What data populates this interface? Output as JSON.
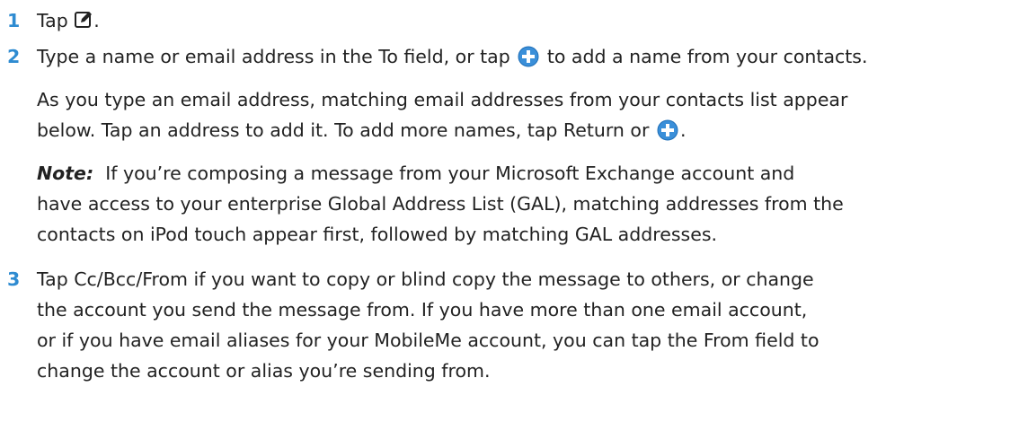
{
  "steps": [
    {
      "number": "1",
      "text_before": "Tap",
      "icon": "compose-icon",
      "text_after": "."
    },
    {
      "number": "2",
      "text_before": "Type a name or email address in the To field, or tap",
      "icon": "add-contact-icon",
      "text_after": "to add a name from your contacts.",
      "detail_before": "As you type an email address, matching email addresses from your contacts list appear",
      "detail_line2_before": "below. Tap an address to add it. To add more names, tap Return or",
      "detail_icon": "add-contact-icon",
      "detail_after": ".",
      "note_label": "Note:",
      "note_lines": [
        "If you’re composing a message from your Microsoft Exchange account and",
        "have access to your enterprise Global Address List (GAL), matching addresses from the",
        "contacts on iPod touch appear first, followed by matching GAL addresses."
      ]
    },
    {
      "number": "3",
      "lines": [
        "Tap Cc/Bcc/From if you want to copy or blind copy the message to others, or change",
        "the account you send the message from. If you have more than one email account,",
        "or if you have email aliases for your MobileMe account, you can tap the From field to",
        "change the account or alias you’re sending from."
      ]
    }
  ],
  "colors": {
    "step_number": "#2e8bd1",
    "icon_blue": "#3a8fd9",
    "text": "#222222"
  }
}
